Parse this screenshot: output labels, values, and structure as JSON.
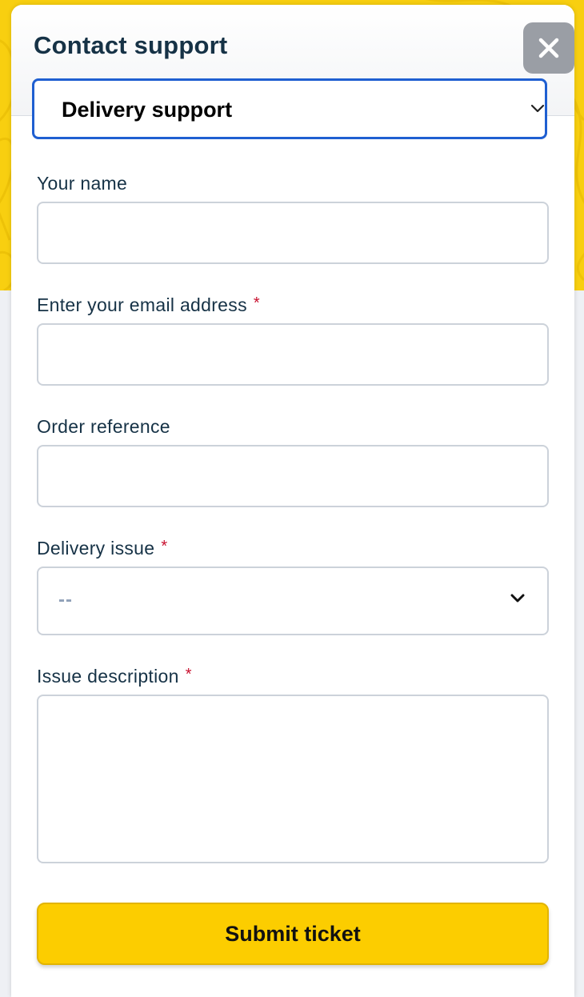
{
  "colors": {
    "backdrop_yellow": "#f8cf10",
    "title_text": "#163246",
    "focus_border": "#1f5fd1",
    "required_asterisk": "#c8102e",
    "submit_background": "#fccd00",
    "close_background": "#9a9ea5"
  },
  "modal": {
    "title": "Contact support",
    "close_icon": "close-icon",
    "category_select": {
      "selected": "Delivery support",
      "icon": "chevron-down-icon"
    }
  },
  "form": {
    "name": {
      "label": "Your name",
      "value": "",
      "required": false
    },
    "email": {
      "label": "Enter your email address",
      "value": "",
      "required": true
    },
    "order_reference": {
      "label": "Order reference",
      "value": "",
      "required": false
    },
    "delivery_issue": {
      "label": "Delivery issue",
      "selected": "--",
      "required": true,
      "icon": "chevron-down-icon"
    },
    "issue_description": {
      "label": "Issue description",
      "value": "",
      "required": true
    },
    "required_marker": "*",
    "submit_label": "Submit ticket"
  }
}
